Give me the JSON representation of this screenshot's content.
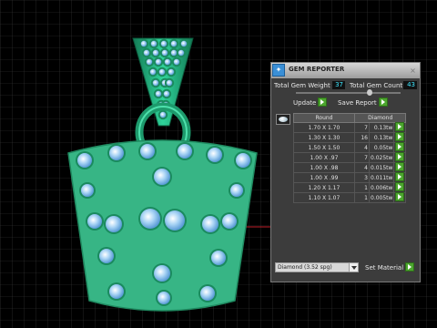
{
  "panel": {
    "title": "GEM REPORTER",
    "close_glyph": "×",
    "total_weight_label": "Total Gem Weight",
    "total_weight_value": "37",
    "total_count_label": "Total Gem Count",
    "total_count_value": "43",
    "update_label": "Update",
    "save_report_label": "Save Report",
    "table": {
      "headers": [
        "Round",
        "Diamond"
      ],
      "rows": [
        {
          "size": "1.70 X 1.70",
          "count": "7",
          "carat": "0.13tw"
        },
        {
          "size": "1.30 X 1.30",
          "count": "16",
          "carat": "0.13tw"
        },
        {
          "size": "1.50 X 1.50",
          "count": "4",
          "carat": "0.05tw"
        },
        {
          "size": "1.00 X .97",
          "count": "7",
          "carat": "0.025tw"
        },
        {
          "size": "1.00 X .98",
          "count": "4",
          "carat": "0.015tw"
        },
        {
          "size": "1.00 X .99",
          "count": "3",
          "carat": "0.011tw"
        },
        {
          "size": "1.20 X 1.17",
          "count": "1",
          "carat": "0.006tw"
        },
        {
          "size": "1.10 X 1.07",
          "count": "1",
          "carat": "0.005tw"
        }
      ]
    },
    "material_select_value": "Diamond  (3.52 spg)",
    "set_material_label": "Set Material"
  },
  "colors": {
    "background": "#000000",
    "grid": "#3a3a3a",
    "pendant_green": "#37b585",
    "stone_blue": "#8fc3ee",
    "accent_button": "#4ca62e"
  },
  "icons": {
    "app_logo": "gem-reporter-logo-icon",
    "close": "close-icon",
    "gem_preview": "diamond-icon"
  }
}
